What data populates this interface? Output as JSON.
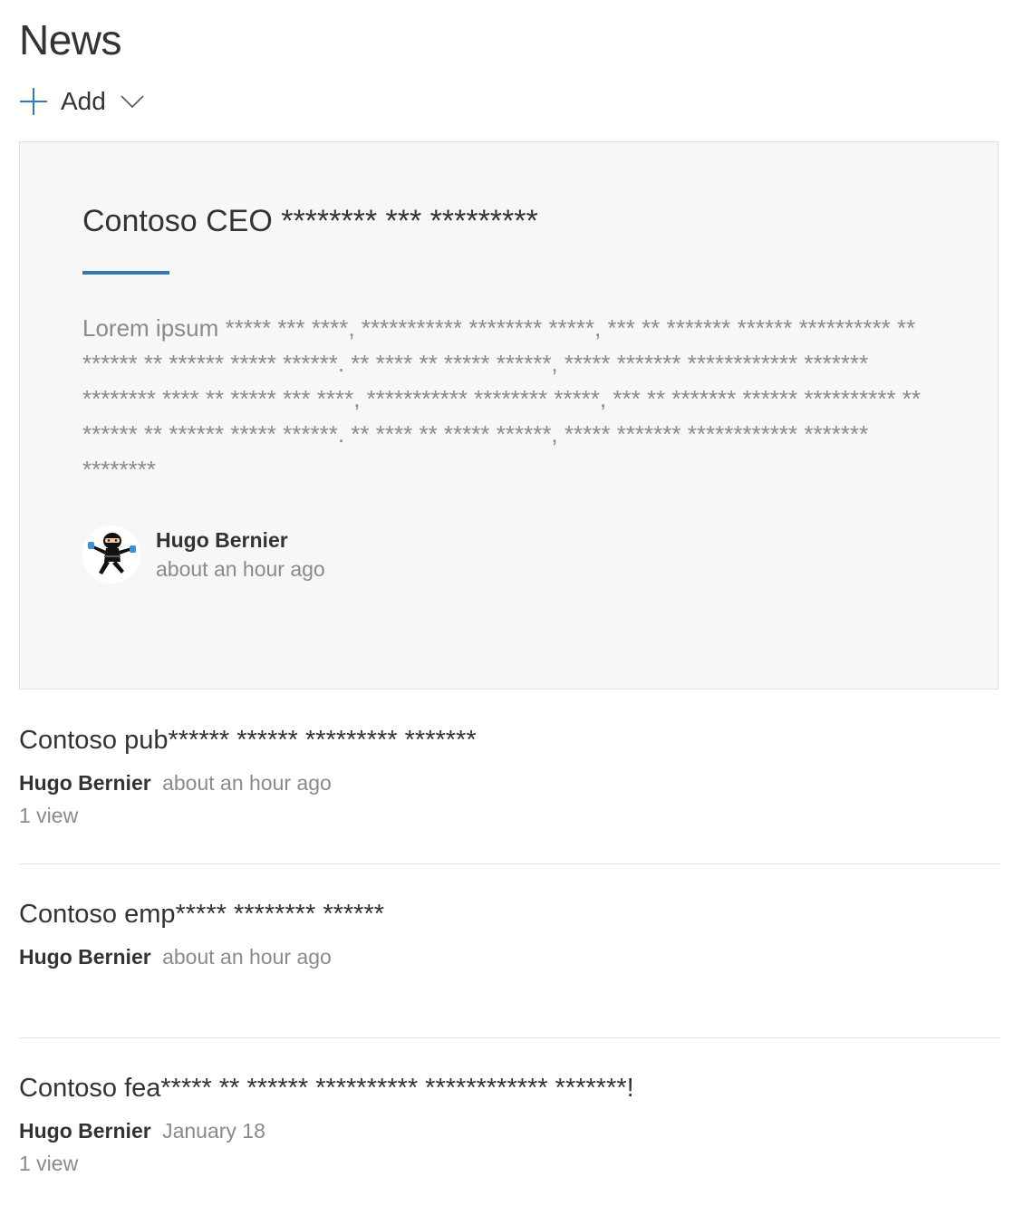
{
  "header": {
    "title": "News",
    "add_label": "Add"
  },
  "colors": {
    "accent": "#2f7ab7",
    "card_background": "#f7f7f7",
    "text_primary": "#333333",
    "text_secondary": "#8a8a8a",
    "divider": "#e1e1e1"
  },
  "icons": {
    "add": "plus-icon",
    "dropdown": "chevron-down-icon"
  },
  "hero": {
    "title": "Contoso CEO ******** *** *********",
    "body": "Lorem ipsum ***** *** ****, *********** ******** *****, *** ** ******* ****** ********** ** ****** ** ****** ***** ******. ** **** ** ***** ******, ***** ******* ************ ******* ******** **** ** ***** *** ****, *********** ******** *****, *** ** ******* ****** ********** ** ****** ** ****** ***** ******. ** **** ** ***** ******, ***** ******* ************ ******* ********",
    "author": "Hugo Bernier",
    "time": "about an hour ago"
  },
  "items": [
    {
      "title": "Contoso pub****** ****** ********* *******",
      "author": "Hugo Bernier",
      "date": "about an hour ago",
      "views": "1 view"
    },
    {
      "title": "Contoso emp***** ******** ******",
      "author": "Hugo Bernier",
      "date": "about an hour ago",
      "views": ""
    },
    {
      "title": "Contoso fea***** ** ****** ********** ************ *******!",
      "author": "Hugo Bernier",
      "date": "January 18",
      "views": "1 view"
    }
  ]
}
